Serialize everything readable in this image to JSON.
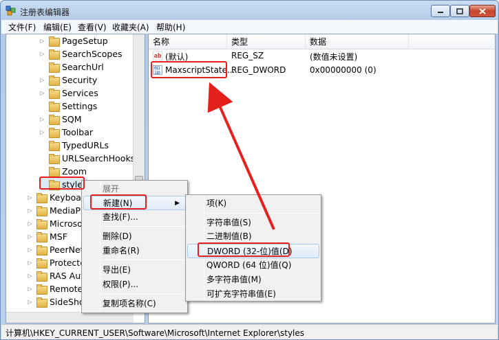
{
  "window": {
    "title": "注册表编辑器"
  },
  "menubar": [
    "文件(F)",
    "编辑(E)",
    "查看(V)",
    "收藏夹(A)",
    "帮助(H)"
  ],
  "tree": {
    "items": [
      {
        "label": "PageSetup"
      },
      {
        "label": "SearchScopes"
      },
      {
        "label": "SearchUrl"
      },
      {
        "label": "Security"
      },
      {
        "label": "Services"
      },
      {
        "label": "Settings"
      },
      {
        "label": "SQM"
      },
      {
        "label": "Toolbar"
      },
      {
        "label": "TypedURLs"
      },
      {
        "label": "URLSearchHooks"
      },
      {
        "label": "Zoom"
      },
      {
        "label": "styles"
      },
      {
        "label": "Keyboard"
      },
      {
        "label": "MediaPlayer"
      },
      {
        "label": "Microsoft"
      },
      {
        "label": "MSF"
      },
      {
        "label": "PeerNet"
      },
      {
        "label": "Protected"
      },
      {
        "label": "RAS Autodial"
      },
      {
        "label": "Remote Assistance"
      },
      {
        "label": "SideShow"
      }
    ]
  },
  "values": {
    "headers": {
      "name": "名称",
      "type": "类型",
      "data": "数据"
    },
    "rows": [
      {
        "icon": "string-value-icon",
        "name": "(默认)",
        "type": "REG_SZ",
        "data": "(数值未设置)"
      },
      {
        "icon": "binary-value-icon",
        "name": "MaxscriptState...",
        "type": "REG_DWORD",
        "data": "0x00000000 (0)"
      }
    ]
  },
  "context_menu": {
    "items": [
      "展开",
      "新建(N)",
      "查找(F)...",
      "删除(D)",
      "重命名(R)",
      "导出(E)",
      "权限(P)...",
      "复制项名称(C)"
    ]
  },
  "submenu": {
    "items": [
      "项(K)",
      "字符串值(S)",
      "二进制值(B)",
      "DWORD (32-位)值(D)",
      "QWORD (64 位)值(Q)",
      "多字符串值(M)",
      "可扩充字符串值(E)"
    ]
  },
  "statusbar": {
    "path": "计算机\\HKEY_CURRENT_USER\\Software\\Microsoft\\Internet Explorer\\styles"
  },
  "colors": {
    "annotation": "#e5211d",
    "highlight": "#dfeaf8"
  }
}
